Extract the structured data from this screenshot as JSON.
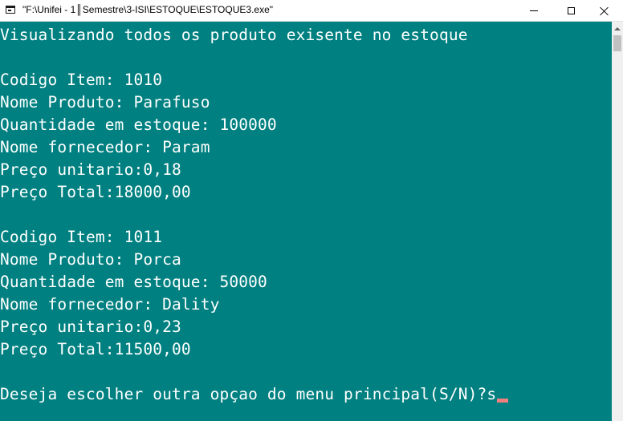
{
  "window": {
    "title": "\"F:\\Unifei - 1║Semestre\\3-ISI\\ESTOQUE\\ESTOQUE3.exe\"",
    "app_icon": "console-window-icon",
    "controls": {
      "minimize_icon": "minimize-icon",
      "maximize_icon": "maximize-icon",
      "close_icon": "close-icon"
    }
  },
  "console": {
    "background_color": "#008080",
    "text_color": "#ffffff",
    "cursor_color": "#f08080",
    "header": "Visualizando todos os produto exisente no estoque",
    "items": [
      {
        "codigo": "Codigo Item: 1010",
        "nome_produto": "Nome Produto: Parafuso",
        "quantidade": "Quantidade em estoque: 100000",
        "fornecedor": "Nome fornecedor: Param",
        "preco_unitario": "Preço unitario:0,18",
        "preco_total": "Preço Total:18000,00"
      },
      {
        "codigo": "Codigo Item: 1011",
        "nome_produto": "Nome Produto: Porca",
        "quantidade": "Quantidade em estoque: 50000",
        "fornecedor": "Nome fornecedor: Dality",
        "preco_unitario": "Preço unitario:0,23",
        "preco_total": "Preço Total:11500,00"
      }
    ],
    "prompt": "Deseja escolher outra opçao do menu principal(S/N)?",
    "input_value": "s"
  }
}
